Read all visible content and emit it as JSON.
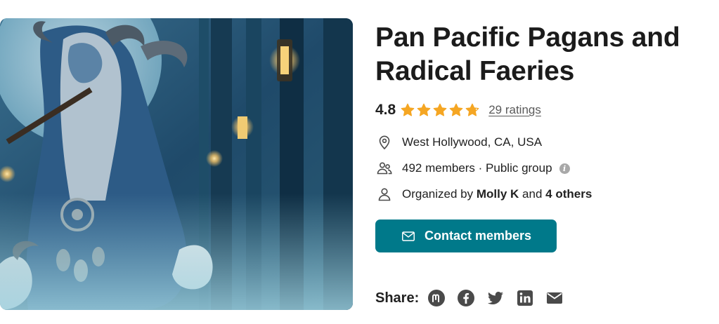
{
  "group": {
    "title": "Pan Pacific Pagans and Radical Faeries",
    "rating_value": "4.8",
    "rating": 4.8,
    "stars_max": 5,
    "ratings_link": "29 ratings",
    "location": "West Hollywood, CA, USA",
    "members_text": "492 members · Public group",
    "organized_prefix": "Organized by",
    "organizer": "Molly K",
    "organized_and": "and",
    "others": "4 others",
    "info_icon_glyph": "i"
  },
  "actions": {
    "contact_label": "Contact members"
  },
  "share": {
    "label": "Share:",
    "icons": [
      "meetup-icon",
      "facebook-icon",
      "twitter-icon",
      "linkedin-icon",
      "email-icon"
    ]
  },
  "colors": {
    "accent": "#00798a",
    "star": "#f5a623",
    "text": "#212121",
    "muted": "#5a5a5a",
    "icon": "#4a4a4a"
  }
}
